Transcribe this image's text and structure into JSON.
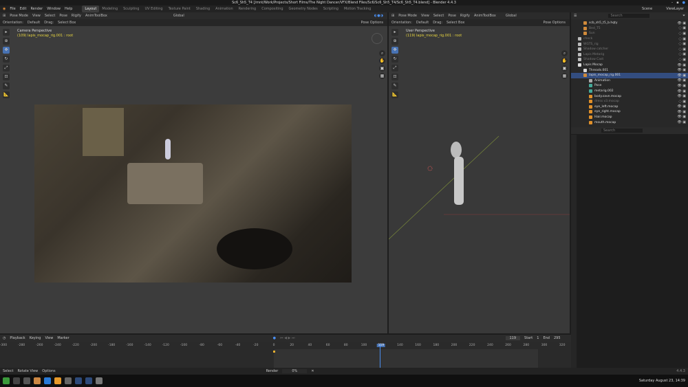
{
  "title": "Sc6_Sh5_T4 [/mnt/Work/Projects/Short Films/The Night Dancer/VFX/Blend Files/Sc6/Sc6_Sh5_T4/Sc6_Sh5_T4.blend] - Blender 4.4.3",
  "menu": [
    "File",
    "Edit",
    "Render",
    "Window",
    "Help"
  ],
  "workspaces": [
    "Layout",
    "Modeling",
    "Sculpting",
    "UV Editing",
    "Texture Paint",
    "Shading",
    "Animation",
    "Rendering",
    "Compositing",
    "Geometry Nodes",
    "Scripting",
    "Motion Tracking"
  ],
  "scene": "Scene",
  "view_layer": "ViewLayer",
  "vp_header": {
    "mode": "Pose Mode",
    "items": [
      "View",
      "Select",
      "Pose",
      "Rigify",
      "AnimToolBox"
    ],
    "transform": "Global",
    "pose_options": "Pose Options",
    "orientation_label": "Orientation:",
    "orientation": "Default",
    "drag_label": "Drag:",
    "drag": "Select Box"
  },
  "left_vp": {
    "view": "Camera Perspective",
    "object": "(109) lapis_mocap_rig.001 : root"
  },
  "right_vp": {
    "view": "User Perspective",
    "object": "(119) lapis_mocap_rig.001 : root"
  },
  "outliner": {
    "search": "Search",
    "items": [
      {
        "label": "scb_sh5_t5_b.hqty",
        "dim": false,
        "sel": false,
        "color": "#d08a3a"
      },
      {
        "label": "Bed_T5",
        "dim": true,
        "sel": false,
        "color": "#d08a3a"
      },
      {
        "label": "Sun",
        "dim": true,
        "sel": false,
        "color": "#d08a3a"
      },
      {
        "label": "check",
        "dim": true,
        "sel": false,
        "color": "#bbb"
      },
      {
        "label": "WGTS_rig",
        "dim": true,
        "sel": false,
        "color": "#bbb"
      },
      {
        "label": "Shadow catcher",
        "dim": true,
        "sel": false,
        "color": "#bbb"
      },
      {
        "label": "Lapis Metarig",
        "dim": true,
        "sel": false,
        "color": "#bbb"
      },
      {
        "label": "Shadow Cast",
        "dim": true,
        "sel": false,
        "color": "#bbb"
      },
      {
        "label": "Lapis Mocap",
        "dim": false,
        "sel": false,
        "color": "#ddd"
      },
      {
        "label": "Threads.001",
        "dim": false,
        "sel": false,
        "color": "#ddd"
      },
      {
        "label": "lapis_mocap_rig.001",
        "dim": false,
        "sel": true,
        "color": "#d08a3a"
      },
      {
        "label": "Animation",
        "dim": false,
        "sel": false,
        "color": "#aaa"
      },
      {
        "label": "Pose",
        "dim": false,
        "sel": false,
        "color": "#4a9"
      },
      {
        "label": "metarig.002",
        "dim": false,
        "sel": false,
        "color": "#4a9"
      },
      {
        "label": "body.save.mocap",
        "dim": false,
        "sel": false,
        "color": "#e0902a"
      },
      {
        "label": "dress v3.mocap",
        "dim": true,
        "sel": false,
        "color": "#e0902a"
      },
      {
        "label": "eye_left.mocap",
        "dim": false,
        "sel": false,
        "color": "#e0902a"
      },
      {
        "label": "eye_right.mocap",
        "dim": false,
        "sel": false,
        "color": "#e0902a"
      },
      {
        "label": "Hair.mocap",
        "dim": false,
        "sel": false,
        "color": "#e0902a"
      },
      {
        "label": "mouth.mocap",
        "dim": false,
        "sel": false,
        "color": "#e0902a"
      }
    ]
  },
  "timeline": {
    "menus": [
      "Playback",
      "Keying",
      "View",
      "Marker"
    ],
    "current_frame": "119",
    "start_label": "Start",
    "start": "1",
    "end_label": "End",
    "end": "295",
    "ticks": [
      "-300",
      "-280",
      "-260",
      "-240",
      "-220",
      "-200",
      "-180",
      "-160",
      "-140",
      "-120",
      "-100",
      "-80",
      "-60",
      "-40",
      "-20",
      "0",
      "20",
      "40",
      "60",
      "80",
      "100",
      "119",
      "140",
      "160",
      "180",
      "200",
      "220",
      "240",
      "260",
      "280",
      "300",
      "320"
    ]
  },
  "status": {
    "hints": [
      "Select",
      "Rotate View",
      "Options"
    ],
    "render_label": "Render",
    "render_progress": "0%",
    "version": "4.4.3"
  },
  "taskbar": {
    "clock": "Saturday August 23, 14:39",
    "apps": [
      "#3b9a3b",
      "#444",
      "#555",
      "#c84",
      "#2a7bd8",
      "#e89a2a",
      "#666",
      "#2d4a7a",
      "#2d4a7a",
      "#777"
    ]
  }
}
